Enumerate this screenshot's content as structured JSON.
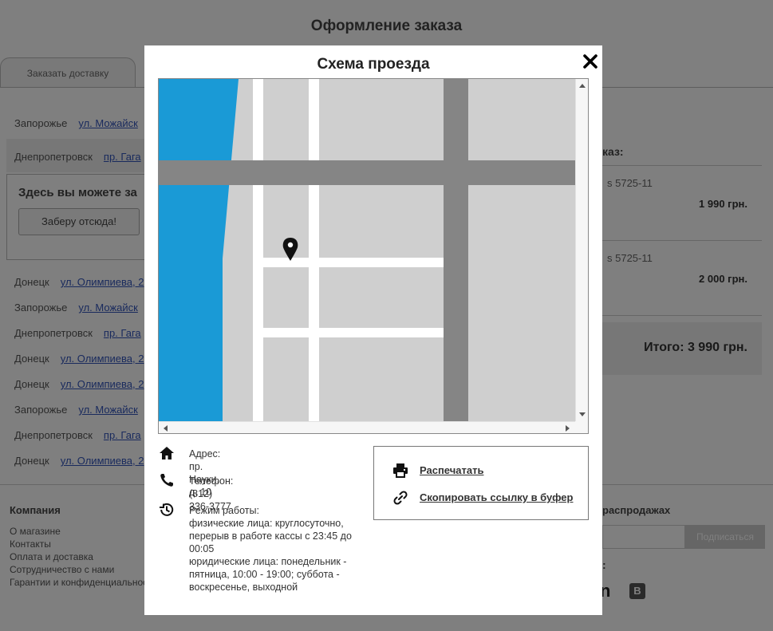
{
  "page": {
    "title": "Оформление заказа",
    "tab_delivery": "Заказать доставку",
    "pickup_text": "Здесь вы можете за",
    "pickup_button": "Заберу отсюда!",
    "addresses": [
      {
        "city": "Запорожье",
        "street": "ул. Можайск"
      },
      {
        "city": "Днепропетровск",
        "street": "пр. Гага"
      },
      {
        "city": "Донецк",
        "street": "ул. Олимпиева, 2"
      },
      {
        "city": "Запорожье",
        "street": "ул. Можайск"
      },
      {
        "city": "Днепропетровск",
        "street": "пр. Гага"
      },
      {
        "city": "Донецк",
        "street": "ул. Олимпиева, 2"
      },
      {
        "city": "Донецк",
        "street": "ул. Олимпиева, 2"
      },
      {
        "city": "Запорожье",
        "street": "ул. Можайск"
      },
      {
        "city": "Днепропетровск",
        "street": "пр. Гага"
      },
      {
        "city": "Донецк",
        "street": "ул. Олимпиева, 2"
      }
    ],
    "order": {
      "heading": "каз:",
      "items": [
        {
          "name": "s 5725-11",
          "price": "1 990 грн."
        },
        {
          "name": "s 5725-11",
          "price": "2 000 грн."
        }
      ],
      "total": "Итого: 3 990 грн."
    },
    "footer": {
      "company_heading": "Компания",
      "links": [
        "О магазине",
        "Контакты",
        "Оплата и доставка",
        "Сотрудничество с нами",
        "Гарантии и конфиденциальность"
      ],
      "sales_heading": "распродажах",
      "subscribe_button": "Подписаться",
      "social_heading": ":",
      "social_n": "n",
      "social_vk": "B"
    }
  },
  "modal": {
    "title": "Схема проезда",
    "close_icon": "close-icon",
    "address": "Адрес: пр. Науки, д. 10",
    "phone": "Телефон: (812) 336-3777",
    "hours_label": "Режим работы:",
    "hours_lines": [
      "физические лица: круглосуточно, перерыв в работе кассы с 23:45 до 00:05",
      "юридические лица: понедельник - пятница, 10:00 - 19:00; суббота - воскресенье, выходной"
    ],
    "print_label": "Распечатать",
    "copy_link_label": "Скопировать ссылку в буфер"
  },
  "colors": {
    "water": "#1a9ad6",
    "block": "#cfcfcf",
    "road": "#ffffff",
    "major_road": "#858585",
    "overlay": "rgba(0,0,0,0.5)"
  }
}
